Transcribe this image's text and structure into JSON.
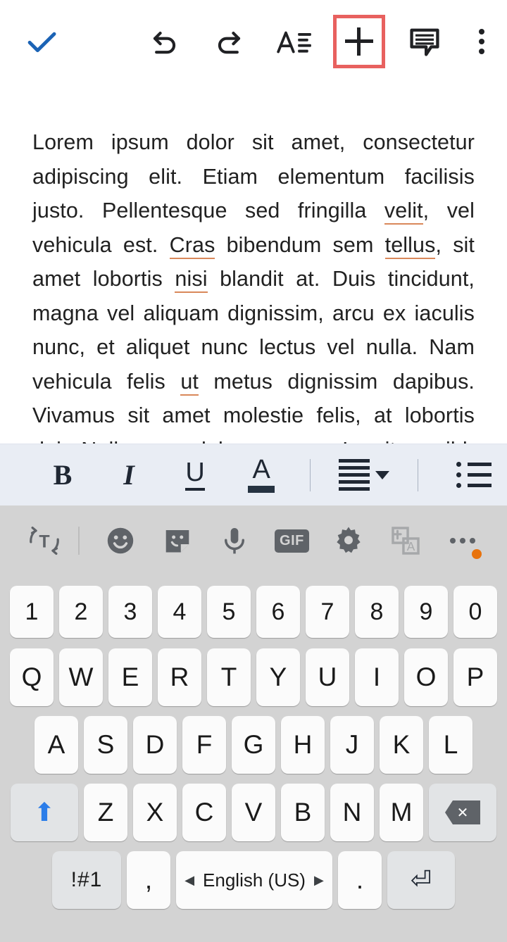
{
  "app_toolbar": {
    "buttons": [
      {
        "name": "done-check",
        "label": "✓",
        "icon": "check-icon",
        "color": "#1b63b5"
      },
      {
        "name": "undo",
        "label": "",
        "icon": "undo-icon"
      },
      {
        "name": "redo",
        "label": "",
        "icon": "redo-icon"
      },
      {
        "name": "format",
        "label": "",
        "icon": "format-text-icon"
      },
      {
        "name": "insert",
        "label": "",
        "icon": "plus-icon",
        "highlighted": true,
        "highlight_color": "#e8615f"
      },
      {
        "name": "comment",
        "label": "",
        "icon": "comment-icon"
      },
      {
        "name": "overflow",
        "label": "",
        "icon": "kebab-menu-icon"
      }
    ]
  },
  "document": {
    "paragraph_parts": [
      {
        "text": "Lorem ipsum dolor sit amet, consectetur adipiscing elit. Etiam elementum facilisis justo. Pellentesque sed fringilla ",
        "misspelled": false
      },
      {
        "text": "velit",
        "misspelled": true
      },
      {
        "text": ", vel vehicula est. ",
        "misspelled": false
      },
      {
        "text": "Cras",
        "misspelled": true
      },
      {
        "text": " bibendum sem ",
        "misspelled": false
      },
      {
        "text": "tellus",
        "misspelled": true
      },
      {
        "text": ", sit amet lobortis ",
        "misspelled": false
      },
      {
        "text": "nisi",
        "misspelled": true
      },
      {
        "text": " blandit at. Duis tincidunt, magna vel aliquam dignissim, arcu ex iaculis nunc, et aliquet nunc lectus vel nulla. Nam vehicula felis ",
        "misspelled": false
      },
      {
        "text": "ut",
        "misspelled": true
      },
      {
        "text": " metus dignissim dapibus. Vivamus sit amet molestie felis, at lobortis dui. Nulla non ",
        "misspelled": false
      },
      {
        "text": "dolor",
        "misspelled": true
      },
      {
        "text": " magna. In vitae nibh facilisis tempor ligula nec rhoncus ligula.",
        "misspelled": false
      }
    ]
  },
  "format_toolbar": {
    "bold_label": "B",
    "italic_label": "I",
    "underline_label": "U",
    "text_color_label": "A",
    "items": [
      {
        "name": "bold",
        "icon": "bold-icon"
      },
      {
        "name": "italic",
        "icon": "italic-icon"
      },
      {
        "name": "underline",
        "icon": "underline-icon"
      },
      {
        "name": "text-color",
        "icon": "text-color-icon"
      },
      {
        "name": "alignment",
        "icon": "align-justify-icon"
      },
      {
        "name": "bulleted-list",
        "icon": "bulleted-list-icon"
      }
    ],
    "background": "#e9edf4"
  },
  "keyboard": {
    "background": "#d3d3d3",
    "toolbar": [
      {
        "name": "clipboard-translate",
        "icon": "t-refresh-icon",
        "label": "T"
      },
      {
        "name": "emoji",
        "icon": "emoji-smiley-icon"
      },
      {
        "name": "sticker",
        "icon": "sticker-icon"
      },
      {
        "name": "voice-input",
        "icon": "microphone-icon"
      },
      {
        "name": "gif",
        "icon": "gif-icon",
        "label": "GIF"
      },
      {
        "name": "settings",
        "icon": "gear-icon"
      },
      {
        "name": "translate",
        "icon": "translate-icon",
        "disabled": true
      },
      {
        "name": "more",
        "icon": "more-horizontal-icon",
        "badge": true,
        "badge_color": "#e8730d"
      }
    ],
    "rows": {
      "numbers": [
        "1",
        "2",
        "3",
        "4",
        "5",
        "6",
        "7",
        "8",
        "9",
        "0"
      ],
      "top": [
        "Q",
        "W",
        "E",
        "R",
        "T",
        "Y",
        "U",
        "I",
        "O",
        "P"
      ],
      "home": [
        "A",
        "S",
        "D",
        "F",
        "G",
        "H",
        "J",
        "K",
        "L"
      ],
      "bottom": [
        "Z",
        "X",
        "C",
        "V",
        "B",
        "N",
        "M"
      ]
    },
    "shift_label": "⬆",
    "shift_color": "#2b7de9",
    "backspace_label": "⌫",
    "symbols_key_label": "!#1",
    "comma_label": ",",
    "period_label": ".",
    "space_label": "English (US)",
    "space_left_arrow": "◀",
    "space_right_arrow": "▶",
    "enter_label": "⏎"
  }
}
